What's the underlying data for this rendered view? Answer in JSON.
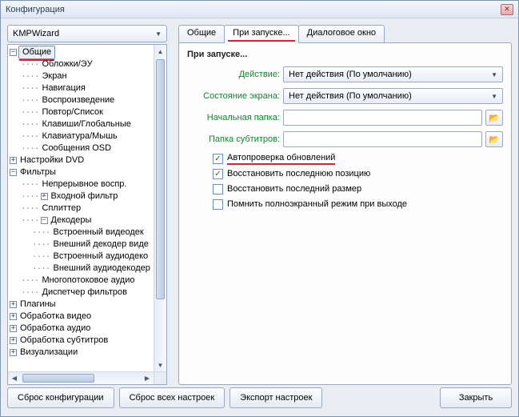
{
  "window": {
    "title": "Конфигурация"
  },
  "combo": {
    "value": "KMPWizard"
  },
  "tabs": [
    {
      "label": "Общие"
    },
    {
      "label": "При запуске..."
    },
    {
      "label": "Диалоговое окно"
    }
  ],
  "active_tab": 1,
  "section_title": "При запуске...",
  "form": {
    "action_label": "Действие:",
    "action_value": "Нет действия (По умолчанию)",
    "screen_label": "Состояние экрана:",
    "screen_value": "Нет действия (По умолчанию)",
    "start_folder_label": "Начальная папка:",
    "start_folder_value": "",
    "subs_folder_label": "Папка субтитров:",
    "subs_folder_value": ""
  },
  "checks": {
    "auto_update": "Автопроверка обновлений",
    "restore_pos": "Восстановить последнюю позицию",
    "restore_size": "Восстановить последний размер",
    "remember_fs": "Помнить полноэкранный режим при выходе"
  },
  "tree": {
    "n0": "Общие",
    "n0c": [
      "Обложки/ЭУ",
      "Экран",
      "Навигация",
      "Воспроизведение",
      "Повтор/Список",
      "Клавиши/Глобальные",
      "Клавиатура/Мышь",
      "Сообщения OSD"
    ],
    "n1": "Настройки DVD",
    "n2": "Фильтры",
    "n2c": [
      "Непрерывное воспр.",
      "Входной фильтр",
      "Сплиттер"
    ],
    "n2d": "Декодеры",
    "n2dc": [
      "Встроенный видеодек",
      "Внешний декодер виде",
      "Встроенный аудиодеко",
      "Внешний аудиодекодер"
    ],
    "n2e": [
      "Многопотоковое аудио",
      "Диспетчер фильтров"
    ],
    "n3": "Плагины",
    "n4": "Обработка видео",
    "n5": "Обработка аудио",
    "n6": "Обработка субтитров",
    "n7": "Визуализации"
  },
  "buttons": {
    "reset_config": "Сброс конфигурации",
    "reset_all": "Сброс всех настроек",
    "export": "Экспорт настроек",
    "close": "Закрыть"
  }
}
